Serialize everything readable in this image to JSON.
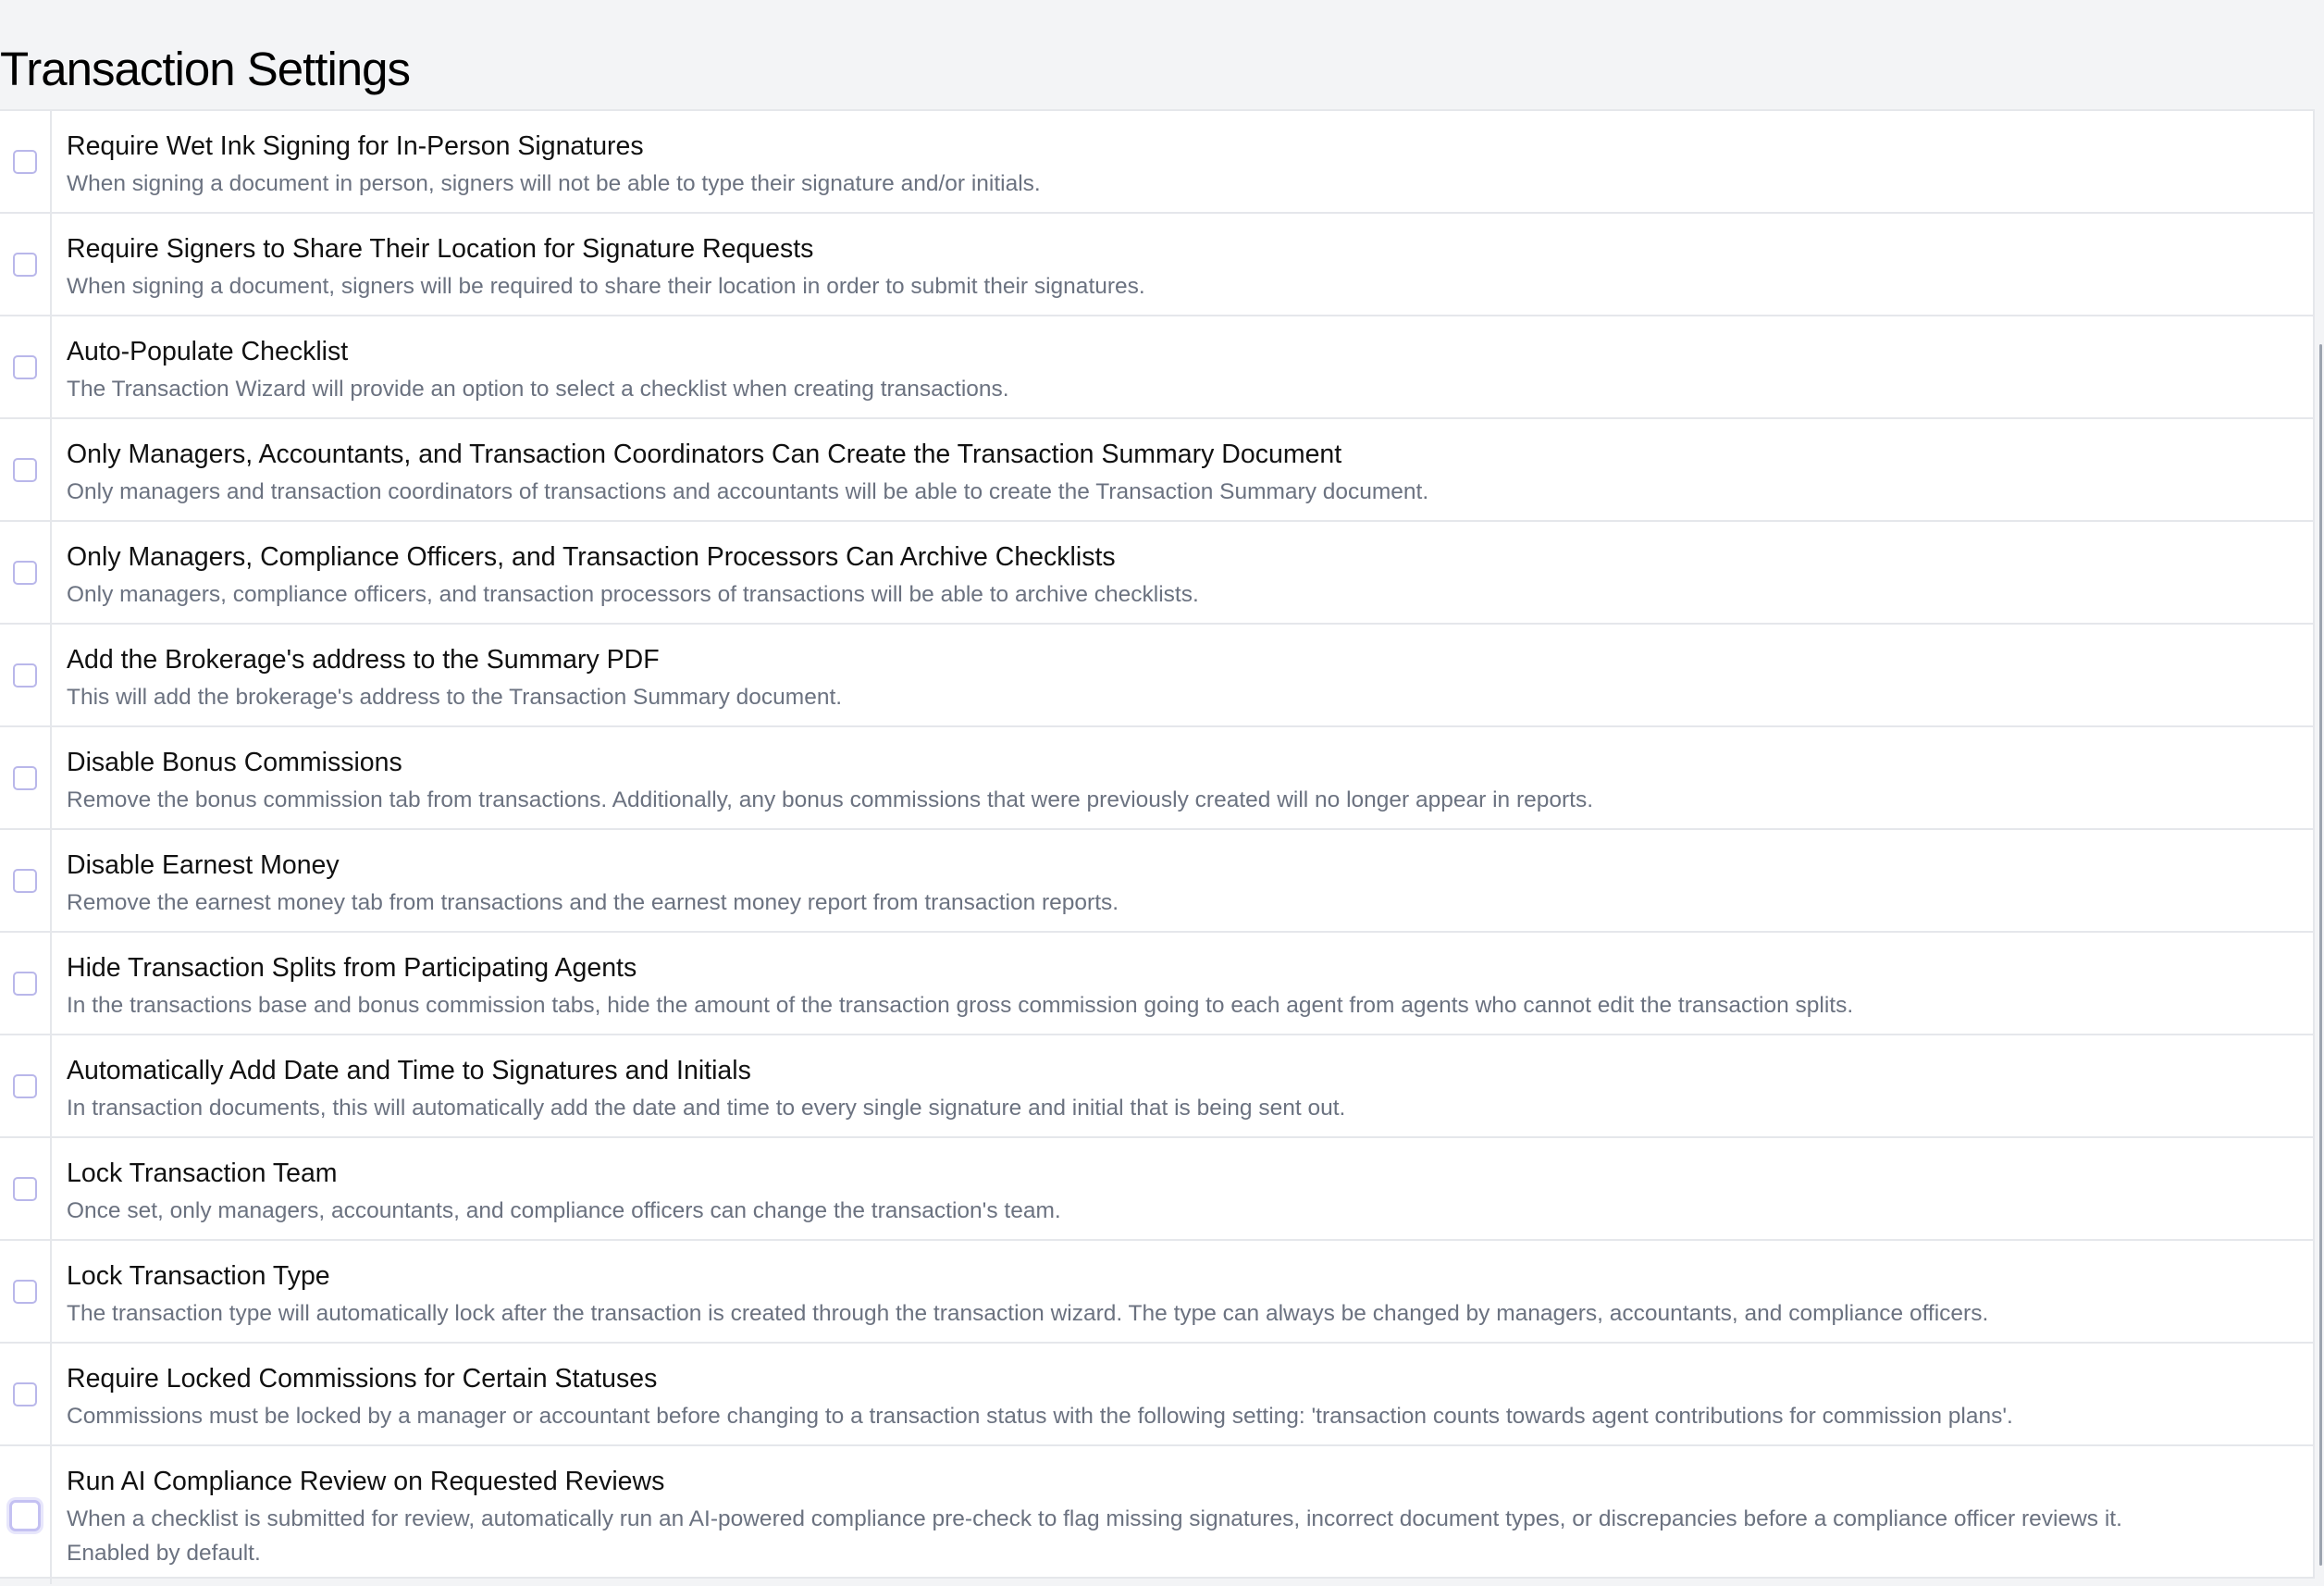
{
  "page": {
    "title": "Transaction Settings"
  },
  "settings": [
    {
      "title": "Require Wet Ink Signing for In-Person Signatures",
      "description": "When signing a document in person, signers will not be able to type their signature and/or initials.",
      "checked": false
    },
    {
      "title": "Require Signers to Share Their Location for Signature Requests",
      "description": "When signing a document, signers will be required to share their location in order to submit their signatures.",
      "checked": false
    },
    {
      "title": "Auto-Populate Checklist",
      "description": "The Transaction Wizard will provide an option to select a checklist when creating transactions.",
      "checked": false
    },
    {
      "title": "Only Managers, Accountants, and Transaction Coordinators Can Create the Transaction Summary Document",
      "description": "Only managers and transaction coordinators of transactions and accountants will be able to create the Transaction Summary document.",
      "checked": false
    },
    {
      "title": "Only Managers, Compliance Officers, and Transaction Processors Can Archive Checklists",
      "description": "Only managers, compliance officers, and transaction processors of transactions will be able to archive checklists.",
      "checked": false
    },
    {
      "title": "Add the Brokerage's address to the Summary PDF",
      "description": "This will add the brokerage's address to the Transaction Summary document.",
      "checked": false
    },
    {
      "title": "Disable Bonus Commissions",
      "description": "Remove the bonus commission tab from transactions. Additionally, any bonus commissions that were previously created will no longer appear in reports.",
      "checked": false
    },
    {
      "title": "Disable Earnest Money",
      "description": "Remove the earnest money tab from transactions and the earnest money report from transaction reports.",
      "checked": false
    },
    {
      "title": "Hide Transaction Splits from Participating Agents",
      "description": "In the transactions base and bonus commission tabs, hide the amount of the transaction gross commission going to each agent from agents who cannot edit the transaction splits.",
      "checked": false
    },
    {
      "title": "Automatically Add Date and Time to Signatures and Initials",
      "description": "In transaction documents, this will automatically add the date and time to every single signature and initial that is being sent out.",
      "checked": false
    },
    {
      "title": "Lock Transaction Team",
      "description": "Once set, only managers, accountants, and compliance officers can change the transaction's team.",
      "checked": false
    },
    {
      "title": "Lock Transaction Type",
      "description": "The transaction type will automatically lock after the transaction is created through the transaction wizard. The type can always be changed by managers, accountants, and compliance officers.",
      "checked": false
    },
    {
      "title": "Require Locked Commissions for Certain Statuses",
      "description": "Commissions must be locked by a manager or accountant before changing to a transaction status with the following setting: 'transaction counts towards agent contributions for commission plans'.",
      "checked": false
    },
    {
      "title": "Run AI Compliance Review on Requested Reviews",
      "description": "When a checklist is submitted for review, automatically run an AI-powered compliance pre-check to flag missing signatures, incorrect document types, or discrepancies before a compliance officer reviews it.",
      "description_line2": "Enabled by default.",
      "checked": false
    }
  ]
}
